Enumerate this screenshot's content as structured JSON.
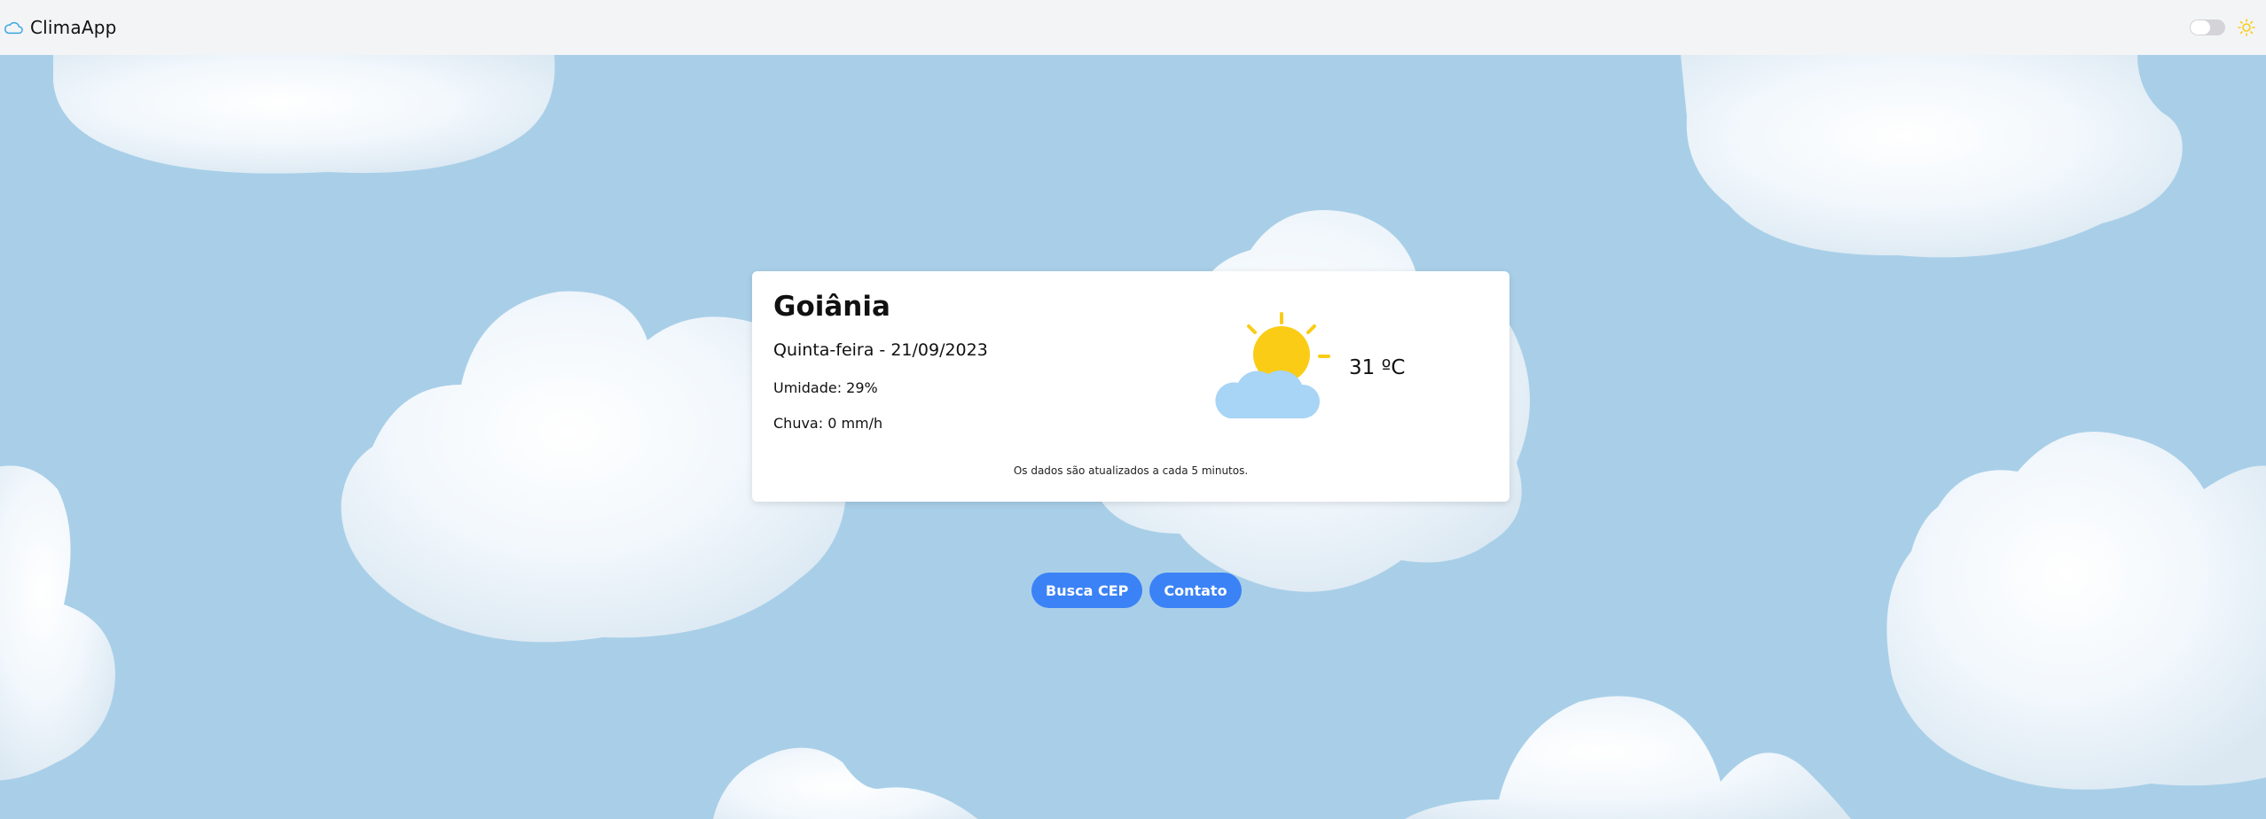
{
  "navbar": {
    "brand_name": "ClimaApp",
    "brand_icon": "cloud-outline-icon",
    "theme_toggle": "toggle-switch",
    "theme_icon": "sun-icon"
  },
  "weather": {
    "city": "Goiânia",
    "date": "Quinta-feira - 21/09/2023",
    "humidity": "Umidade: 29%",
    "rain": "Chuva: 0 mm/h",
    "temperature": "31 ºC",
    "condition_icon": "partly-cloudy-icon",
    "update_note": "Os dados são atualizados a cada 5 minutos."
  },
  "actions": {
    "busca_cep": "Busca CEP",
    "contato": "Contato"
  },
  "colors": {
    "sky": "#a9cfe8",
    "navbar": "#f3f4f6",
    "accent": "#3b82f6",
    "sun": "#facc15",
    "cloud_icon": "#a8d4f5"
  }
}
